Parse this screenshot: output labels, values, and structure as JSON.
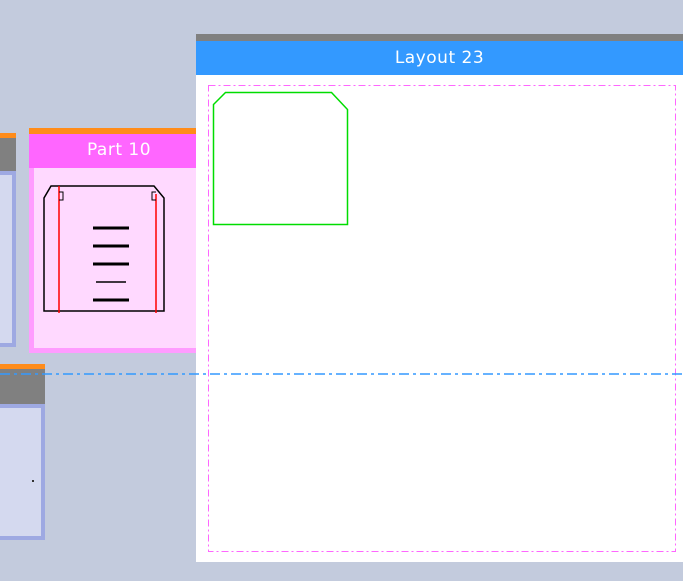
{
  "part": {
    "title": "Part 10"
  },
  "layout": {
    "title": "Layout 23"
  },
  "colors": {
    "workspace": "#c3cbdd",
    "part_header": "#ff66ff",
    "part_body": "#ffd9ff",
    "layout_header": "#3399ff",
    "margin_line": "#ff66ff",
    "placed_part_outline": "#00dd00",
    "divider_line": "#3399ff",
    "accent_orange": "#ff8c1a"
  }
}
